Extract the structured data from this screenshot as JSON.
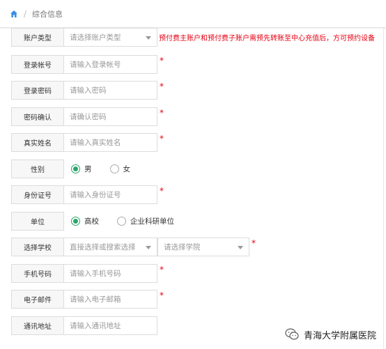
{
  "breadcrumb": {
    "current": "综合信息"
  },
  "form": {
    "account_type": {
      "label": "账户类型",
      "placeholder": "请选择账户类型",
      "note": "预付费主账户和预付费子账户需预先转账至中心充值后，方可预约设备"
    },
    "login_account": {
      "label": "登录帐号",
      "placeholder": "请输入登录帐号"
    },
    "login_password": {
      "label": "登录密码",
      "placeholder": "请输入密码"
    },
    "password_confirm": {
      "label": "密码确认",
      "placeholder": "请确认密码"
    },
    "real_name": {
      "label": "真实姓名",
      "placeholder": "请输入真实姓名"
    },
    "gender": {
      "label": "性别",
      "options": [
        "男",
        "女"
      ],
      "selected": "男"
    },
    "id_number": {
      "label": "身份证号",
      "placeholder": "请输入身份证号"
    },
    "unit": {
      "label": "单位",
      "options": [
        "高校",
        "企业科研单位"
      ],
      "selected": "高校"
    },
    "school": {
      "label": "选择学校",
      "school_placeholder": "直接选择或搜索选择",
      "college_placeholder": "请选择学院"
    },
    "phone": {
      "label": "手机号码",
      "placeholder": "请输入手机号码"
    },
    "email": {
      "label": "电子邮件",
      "placeholder": "请输入电子邮箱"
    },
    "address": {
      "label": "通讯地址",
      "placeholder": "请输入通讯地址"
    },
    "required_mark": "*"
  },
  "watermark": {
    "text": "青海大学附属医院"
  },
  "colors": {
    "accent": "#2aa56a",
    "required": "#e60012"
  }
}
